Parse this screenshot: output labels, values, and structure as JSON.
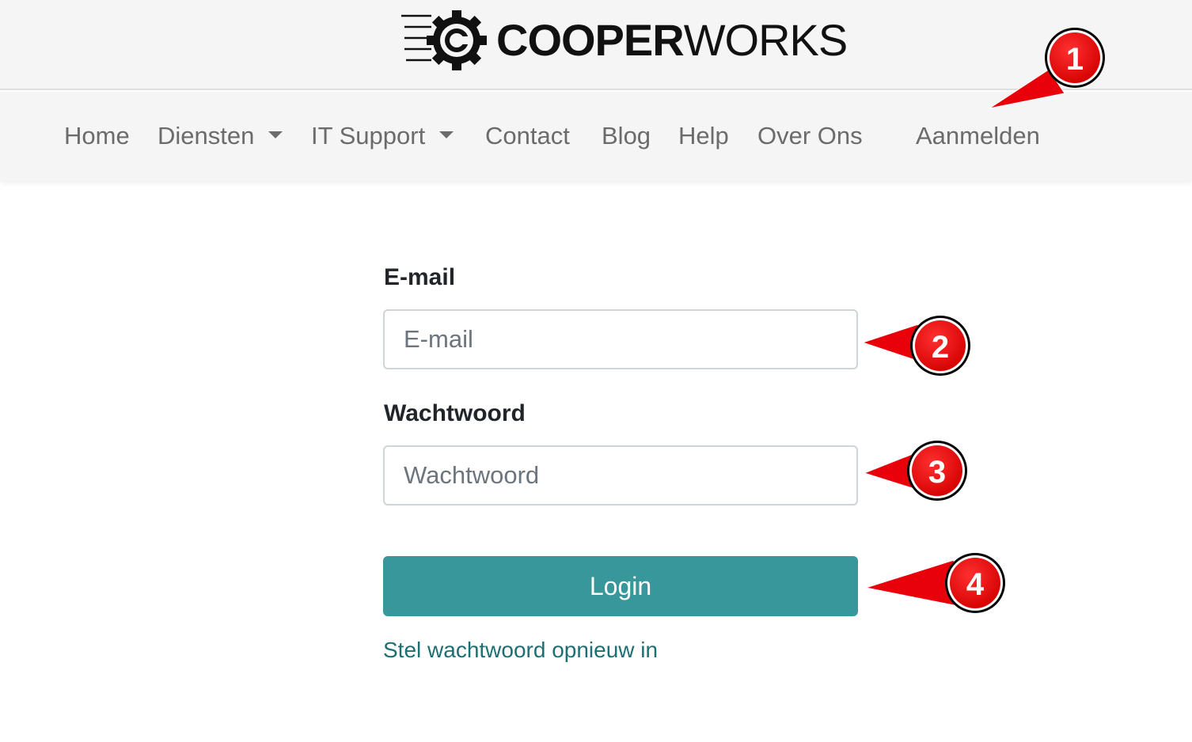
{
  "brand": {
    "name_bold": "COOPER",
    "name_thin": "WORKS"
  },
  "nav": {
    "items": [
      {
        "label": "Home"
      },
      {
        "label": "Diensten"
      },
      {
        "label": "IT Support"
      },
      {
        "label": "Contact"
      },
      {
        "label": "Blog"
      },
      {
        "label": "Help"
      },
      {
        "label": "Over Ons"
      }
    ],
    "login_label": "Aanmelden"
  },
  "form": {
    "email_label": "E-mail",
    "email_placeholder": "E-mail",
    "email_value": "",
    "password_label": "Wachtwoord",
    "password_placeholder": "Wachtwoord",
    "password_value": "",
    "submit_label": "Login",
    "reset_link": "Stel wachtwoord opnieuw in"
  },
  "annotations": [
    "1",
    "2",
    "3",
    "4"
  ],
  "colors": {
    "accent": "#37979a",
    "link": "#1e6f73",
    "marker": "#e8000b"
  }
}
